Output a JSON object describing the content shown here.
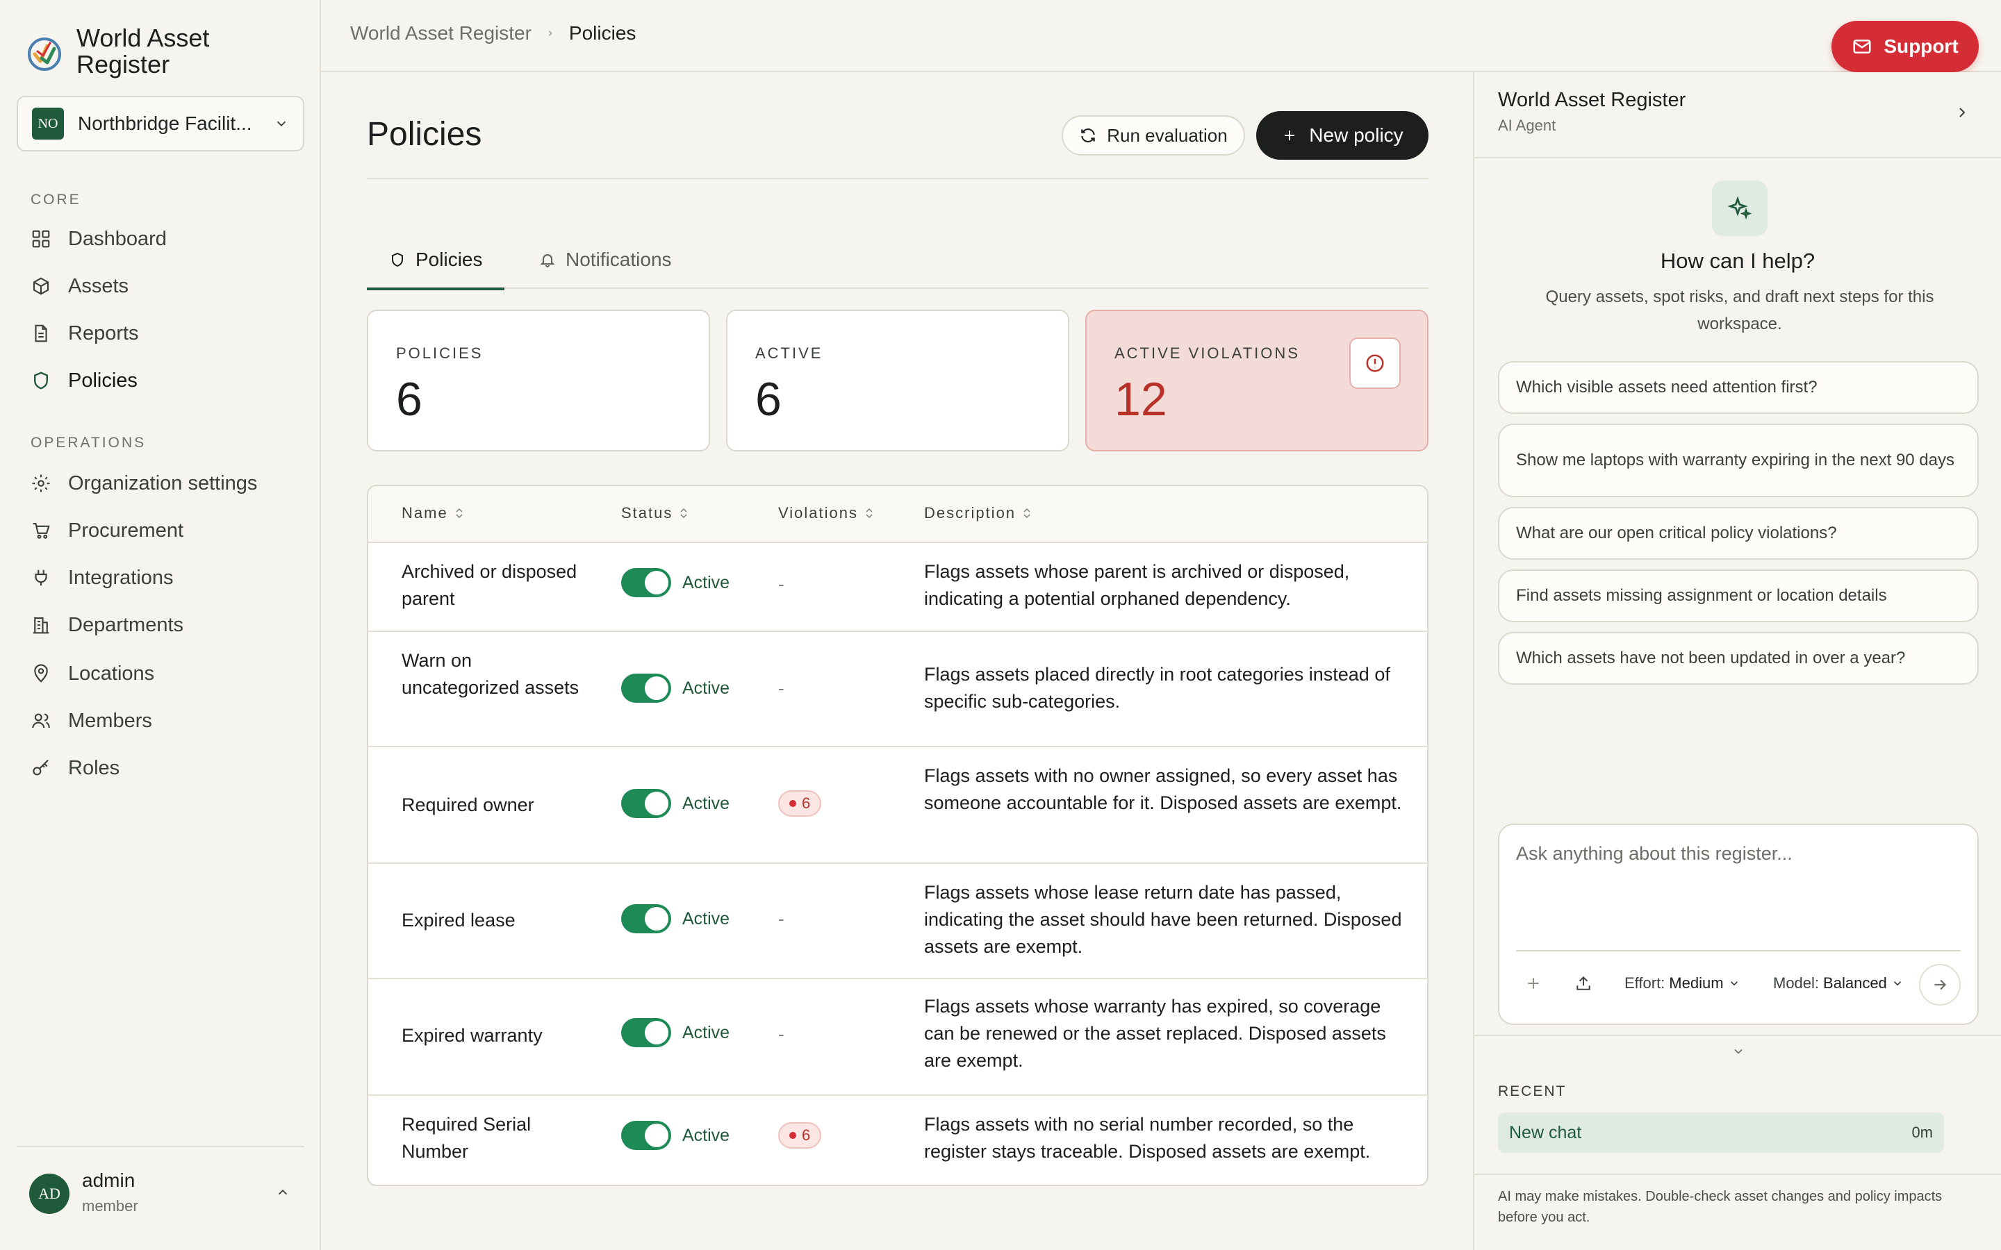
{
  "brand": {
    "name": "World Asset Register"
  },
  "org": {
    "initials": "NO",
    "name": "Northbridge Facilit..."
  },
  "sidebar": {
    "core_label": "CORE",
    "core_items": [
      {
        "label": "Dashboard",
        "icon": "grid-icon"
      },
      {
        "label": "Assets",
        "icon": "box-icon"
      },
      {
        "label": "Reports",
        "icon": "document-icon"
      },
      {
        "label": "Policies",
        "icon": "shield-icon",
        "active": true
      }
    ],
    "operations_label": "OPERATIONS",
    "operations_items": [
      {
        "label": "Organization settings",
        "icon": "gear-icon"
      },
      {
        "label": "Procurement",
        "icon": "cart-icon"
      },
      {
        "label": "Integrations",
        "icon": "plug-icon"
      },
      {
        "label": "Departments",
        "icon": "building-icon"
      },
      {
        "label": "Locations",
        "icon": "map-pin-icon"
      },
      {
        "label": "Members",
        "icon": "users-icon"
      },
      {
        "label": "Roles",
        "icon": "key-icon"
      }
    ]
  },
  "user": {
    "initials": "AD",
    "name": "admin",
    "role": "member"
  },
  "breadcrumb": {
    "root": "World Asset Register",
    "current": "Policies"
  },
  "support": {
    "label": "Support"
  },
  "page": {
    "title": "Policies",
    "run_label": "Run evaluation",
    "new_label": "New policy",
    "tabs": [
      {
        "label": "Policies"
      },
      {
        "label": "Notifications"
      }
    ]
  },
  "stats": [
    {
      "label": "POLICIES",
      "value": "6"
    },
    {
      "label": "ACTIVE",
      "value": "6"
    },
    {
      "label": "ACTIVE VIOLATIONS",
      "value": "12"
    }
  ],
  "table": {
    "headers": [
      "Name",
      "Status",
      "Violations",
      "Description"
    ],
    "rows": [
      {
        "name": "Archived or disposed parent",
        "status": "Active",
        "violations": "-",
        "description": "Flags assets whose parent is archived or disposed, indicating a potential orphaned dependency."
      },
      {
        "name": "Warn on uncategorized assets",
        "status": "Active",
        "violations": "-",
        "description": "Flags assets placed directly in root categories instead of specific sub-categories."
      },
      {
        "name": "Required owner",
        "status": "Active",
        "violations": "6",
        "description": "Flags assets with no owner assigned, so every asset has someone accountable for it. Disposed assets are exempt."
      },
      {
        "name": "Expired lease",
        "status": "Active",
        "violations": "-",
        "description": "Flags assets whose lease return date has passed, indicating the asset should have been returned. Disposed assets are exempt."
      },
      {
        "name": "Expired warranty",
        "status": "Active",
        "violations": "-",
        "description": "Flags assets whose warranty has expired, so coverage can be renewed or the asset replaced. Disposed assets are exempt."
      },
      {
        "name": "Required Serial Number",
        "status": "Active",
        "violations": "6",
        "description": "Flags assets with no serial number recorded, so the register stays traceable. Disposed assets are exempt."
      }
    ]
  },
  "agent": {
    "title": "World Asset Register",
    "subtitle": "AI Agent",
    "help_title": "How can I help?",
    "help_sub": "Query assets, spot risks, and draft next steps for this workspace.",
    "suggestions": [
      "Which visible assets need attention first?",
      "Show me laptops with warranty expiring in the next 90 days",
      "What are our open critical policy violations?",
      "Find assets missing assignment or location details",
      "Which assets have not been updated in over a year?"
    ],
    "input_placeholder": "Ask anything about this register...",
    "effort_label": "Effort:",
    "effort_value": "Medium",
    "model_label": "Model:",
    "model_value": "Balanced",
    "recent_label": "RECENT",
    "recent_items": [
      {
        "title": "New chat",
        "time": "0m"
      }
    ],
    "disclaimer": "AI may make mistakes. Double-check asset changes and policy impacts before you act."
  },
  "colors": {
    "accent": "#1f5a3a",
    "danger": "#d42d36",
    "toggle_on": "#1e8a55"
  }
}
